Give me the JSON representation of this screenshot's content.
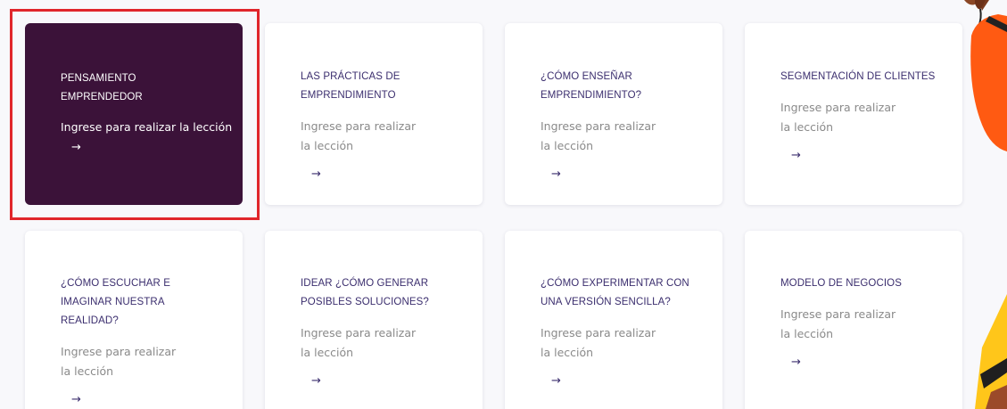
{
  "lessons": [
    {
      "title_line1": "PENSAMIENTO",
      "title_line2": "EMPRENDEDOR",
      "title_line3": "",
      "cta": "Ingrese para realizar la lección",
      "arrow": "→",
      "selected": true
    },
    {
      "title_line1": "LAS PRÁCTICAS DE",
      "title_line2": "EMPRENDIMIENTO",
      "title_line3": "",
      "cta": "Ingrese para realizar la lección",
      "arrow": "→",
      "selected": false
    },
    {
      "title_line1": "¿CÓMO ENSEÑAR",
      "title_line2": "EMPRENDIMIENTO?",
      "title_line3": "",
      "cta": "Ingrese para realizar la lección",
      "arrow": "→",
      "selected": false
    },
    {
      "title_line1": "SEGMENTACIÓN DE CLIENTES",
      "title_line2": "",
      "title_line3": "",
      "cta": "Ingrese para realizar la lección",
      "arrow": "→",
      "selected": false
    },
    {
      "title_line1": "¿CÓMO ESCUCHAR E",
      "title_line2": "IMAGINAR NUESTRA",
      "title_line3": "REALIDAD?",
      "cta": "Ingrese para realizar la lección",
      "arrow": "→",
      "selected": false
    },
    {
      "title_line1": "IDEAR ¿CÓMO GENERAR",
      "title_line2": "POSIBLES SOLUCIONES?",
      "title_line3": "",
      "cta": "Ingrese para realizar la lección",
      "arrow": "→",
      "selected": false
    },
    {
      "title_line1": "¿CÓMO EXPERIMENTAR CON",
      "title_line2": "UNA VERSIÓN SENCILLA?",
      "title_line3": "",
      "cta": "Ingrese para realizar la lección",
      "arrow": "→",
      "selected": false
    },
    {
      "title_line1": "MODELO DE NEGOCIOS",
      "title_line2": "",
      "title_line3": "",
      "cta": "Ingrese para realizar la lección",
      "arrow": "→",
      "selected": false
    }
  ],
  "colors": {
    "active_card": "#3b1239",
    "title_text": "#3b2e6e",
    "cta_text": "#8a8a8a",
    "highlight_border": "#e0262b",
    "page_bg": "#f8f8fb"
  }
}
